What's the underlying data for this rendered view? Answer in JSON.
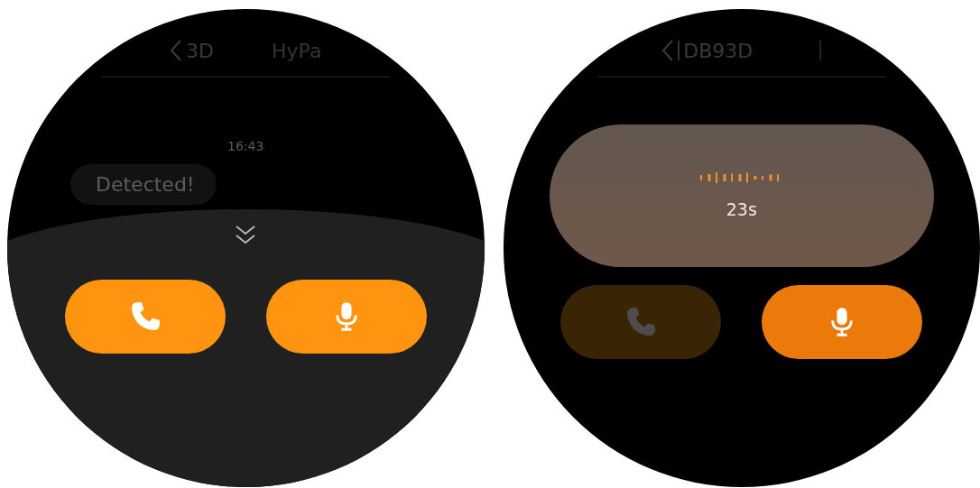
{
  "watches": [
    {
      "kind": "chat",
      "header": {
        "back_label": "3D",
        "title": "HyPa"
      },
      "timestamp": "16:43",
      "message": "Detected!",
      "buttons": [
        {
          "kind": "call",
          "disabled": false
        },
        {
          "kind": "mic",
          "disabled": false
        }
      ]
    },
    {
      "kind": "recording",
      "header": {
        "back_label": "DB93D"
      },
      "elapsed": "23s",
      "buttons": [
        {
          "kind": "call",
          "disabled": true
        },
        {
          "kind": "mic",
          "disabled": false
        }
      ]
    }
  ]
}
